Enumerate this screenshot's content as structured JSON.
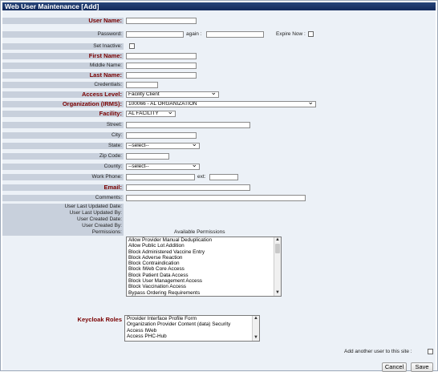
{
  "window": {
    "title": "Web User Maintenance [Add]"
  },
  "labels": {
    "user_name": "User Name:",
    "password": "Password:",
    "again": "again :",
    "expire_now": "Expire Now :",
    "set_inactive": "Set Inactive:",
    "first_name": "First Name:",
    "middle_name": "Middle Name:",
    "last_name": "Last Name:",
    "credentials": "Credentials:",
    "access_level": "Access Level:",
    "organization": "Organization (IRMS):",
    "facility": "Facility:",
    "street": "Street:",
    "city": "City:",
    "state": "State:",
    "zip": "Zip Code:",
    "county": "County:",
    "work_phone": "Work Phone:",
    "ext": "ext:",
    "email": "Email:",
    "comments": "Comments:",
    "user_last_updated_date": "User Last Updated Date:",
    "user_last_updated_by": "User Last Updated By:",
    "user_created_date": "User Created Date:",
    "user_created_by": "User Created By:",
    "permissions": "Permissions:",
    "available_permissions": "Available Permissions",
    "keycloak_roles": "Keycloak Roles",
    "add_another": "Add another user to this site :"
  },
  "values": {
    "access_level": "Facility Client",
    "organization": "100066 - AL ORGANIZATION",
    "facility": "AL FACILITY",
    "state": "--select--",
    "county": "--select--"
  },
  "permissions": [
    "Allow Provider Manual Deduplication",
    "Allow Public Lot Addition",
    "Block Administered Vaccine Entry",
    "Block Adverse Reaction",
    "Block Contraindication",
    "Block IWeb Core Access",
    "Block Patient Data Access",
    "Block User Management Access",
    "Block Vaccination Access",
    "Bypass Ordering Requirements"
  ],
  "keycloak_roles": [
    "Provider Interface Profile Form",
    "Organization Provider Content (data) Security",
    "Access IWeb",
    "Access PHC-Hub"
  ],
  "buttons": {
    "cancel": "Cancel",
    "save": "Save"
  },
  "colors": {
    "title_bar": "#1b3a6e",
    "label_bg": "#c8d0dc",
    "required_label": "#7a0000",
    "frame_bg": "#ecf1f7"
  }
}
